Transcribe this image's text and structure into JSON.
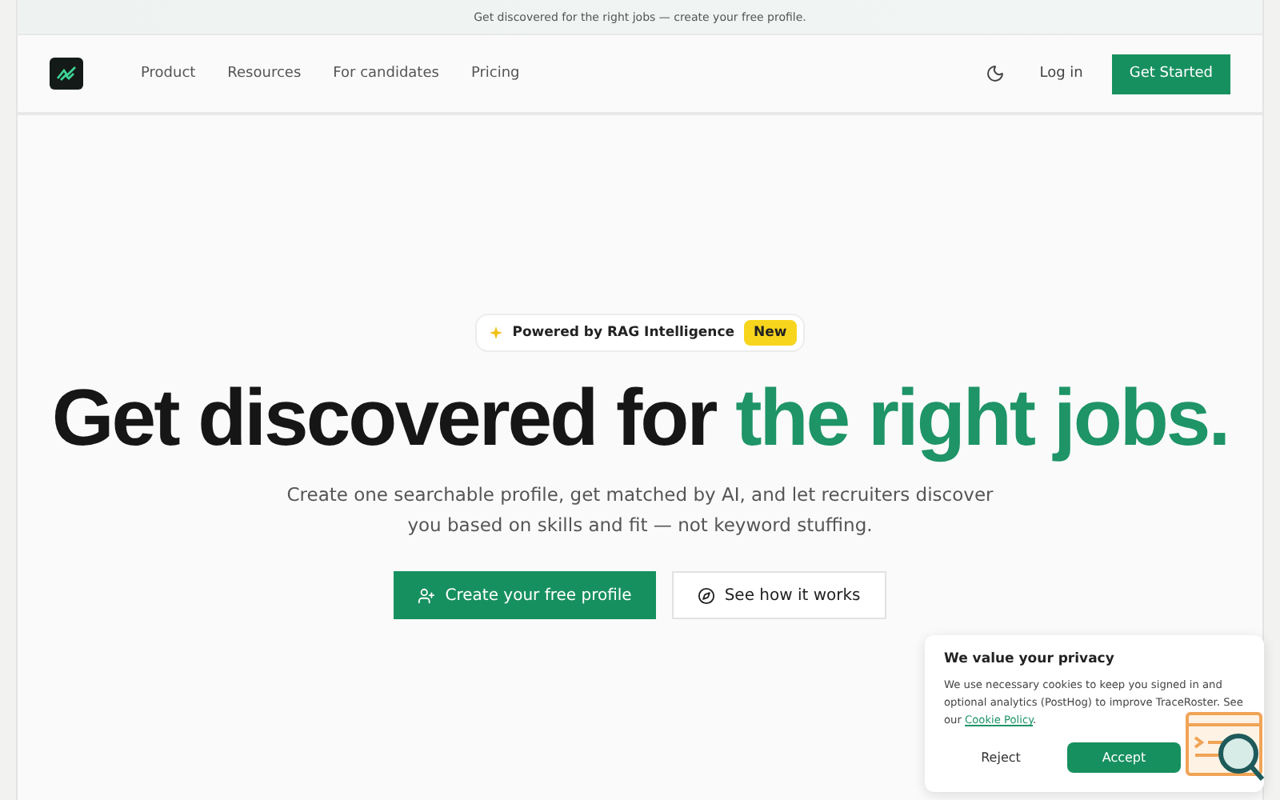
{
  "announcement": "Get discovered for the right jobs — create your free profile.",
  "nav": {
    "links": [
      "Product",
      "Resources",
      "For candidates",
      "Pricing"
    ],
    "login": "Log in",
    "cta": "Get Started"
  },
  "hero": {
    "badge": {
      "label": "Powered by RAG Intelligence",
      "tag": "New"
    },
    "title": "Get discovered for ",
    "title_accent": "the right jobs.",
    "subtitle": "Create one searchable profile, get matched by AI, and let recruiters discover you based on skills and fit — not keyword stuffing.",
    "primary": "Create your free profile",
    "secondary": "See how it works"
  },
  "cookie": {
    "title": "We value your privacy",
    "text": "We use necessary cookies to keep you signed in and optional analytics (PostHog) to improve TraceRoster. See our ",
    "link": "Cookie Policy",
    "after": ".",
    "reject": "Reject",
    "accept": "Accept"
  }
}
